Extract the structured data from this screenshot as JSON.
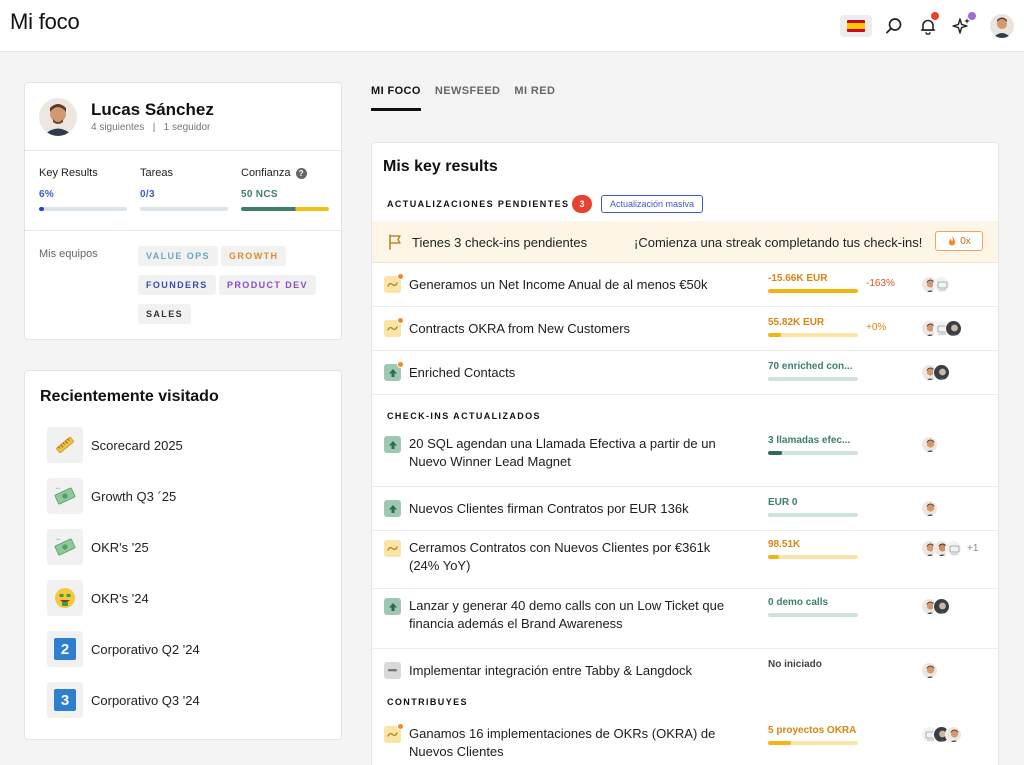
{
  "header": {
    "title": "Mi foco"
  },
  "profile": {
    "name": "Lucas Sánchez",
    "following": "4 siguientes",
    "divider": "|",
    "followers": "1 seguidor",
    "stats": {
      "key_results": {
        "label": "Key Results",
        "value": "6%",
        "progress": 0.06
      },
      "tasks": {
        "label": "Tareas",
        "value": "0/3",
        "progress": 0.0
      },
      "confidence": {
        "label": "Confianza",
        "value": "50 NCS"
      }
    },
    "teams_label": "Mis equipos",
    "teams": [
      {
        "label": "VALUE OPS",
        "color": "#6aa8b8"
      },
      {
        "label": "GROWTH",
        "color": "#e28a2c"
      },
      {
        "label": "FOUNDERS",
        "color": "#3a49b5"
      },
      {
        "label": "PRODUCT DEV",
        "color": "#8c4bc8"
      },
      {
        "label": "SALES",
        "color": "#333333"
      }
    ]
  },
  "recent": {
    "title": "Recientemente visitado",
    "items": [
      {
        "label": "Scorecard 2025",
        "icon": "ruler-icon"
      },
      {
        "label": "Growth Q3 ´25",
        "icon": "money-icon"
      },
      {
        "label": "OKR's '25",
        "icon": "money-icon"
      },
      {
        "label": "OKR's '24",
        "icon": "money-face-icon"
      },
      {
        "label": "Corporativo Q2 '24",
        "icon": "number-2-icon",
        "badge": "2"
      },
      {
        "label": "Corporativo Q3 '24",
        "icon": "number-3-icon",
        "badge": "3"
      }
    ]
  },
  "tabs": [
    "MI FOCO",
    "NEWSFEED",
    "MI RED"
  ],
  "key_results": {
    "title": "Mis key results",
    "pending_label": "ACTUALIZACIONES PENDIENTES",
    "pending_count": "3",
    "mass_update": "Actualización masiva",
    "banner_text": "Tienes 3 check-ins pendientes",
    "streak_text": "¡Comienza una streak completando tus check-ins!",
    "streak_value": "0x",
    "updated_label": "CHECK-INS ACTUALIZADOS",
    "contrib_label": "CONTRIBUYES",
    "pending": [
      {
        "title": "Generamos un Net Income Anual de al menos €50k",
        "metric": "-15.66K EUR",
        "delta": "-163%",
        "color": "orange",
        "progress": 1.0,
        "icon": "yellow",
        "status_icon": "trend-icon"
      },
      {
        "title": "Contracts OKRA from New Customers",
        "metric": "55.82K EUR",
        "delta": "+0%",
        "color": "orange",
        "progress": 0.14,
        "icon": "yellow",
        "status_icon": "trend-icon"
      },
      {
        "title": "Enriched Contacts",
        "metric": "70 enriched con...",
        "delta": "",
        "color": "green",
        "progress": 0.0,
        "icon": "green",
        "status_icon": "arrow-up-icon"
      }
    ],
    "updated": [
      {
        "title": "20 SQL agendan una Llamada Efectiva a partir de un Nuevo Winner Lead Magnet",
        "metric": "3 llamadas efec...",
        "color": "green",
        "progress": 0.15,
        "icon": "green",
        "status_icon": "arrow-up-icon"
      },
      {
        "title": "Nuevos Clientes firman Contratos por EUR 136k",
        "metric": "EUR 0",
        "color": "green",
        "progress": 0.0,
        "icon": "green",
        "status_icon": "arrow-up-icon"
      },
      {
        "title": "Cerramos Contratos con Nuevos Clientes por €361k (24% YoY)",
        "metric": "98.51K",
        "color": "orange",
        "progress": 0.12,
        "icon": "yellow",
        "status_icon": "trend-icon",
        "extra": "+1"
      },
      {
        "title": "Lanzar y generar 40 demo calls con un Low Ticket que financia además el Brand Awareness",
        "metric": "0 demo calls",
        "color": "green",
        "progress": 0.0,
        "icon": "green",
        "status_icon": "arrow-up-icon"
      },
      {
        "title": "Implementar integración entre Tabby & Langdock",
        "metric": "No iniciado",
        "color": "gray",
        "icon": "gray",
        "status_icon": "minus-icon"
      }
    ],
    "contributes": [
      {
        "title": "Ganamos 16 implementaciones de OKRs (OKRA) de Nuevos Clientes",
        "metric": "5 proyectos OKRA",
        "color": "orange",
        "progress": 0.25,
        "icon": "yellow",
        "status_icon": "trend-icon"
      }
    ]
  },
  "colors": {
    "accent": "#3d5ad0",
    "orange": "#d98512",
    "green": "#3d8066",
    "badge_red": "#e8412f"
  }
}
